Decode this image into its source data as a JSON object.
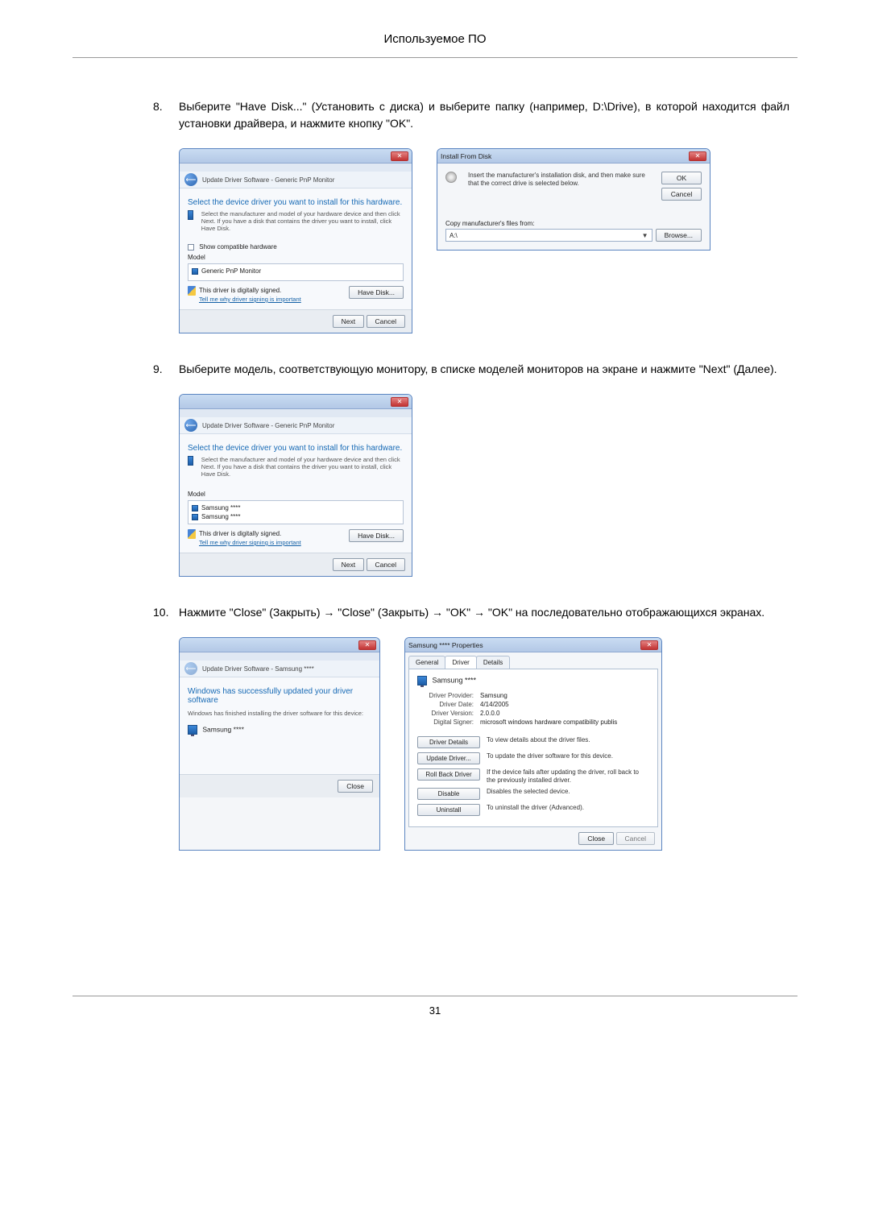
{
  "header_title": "Используемое ПО",
  "page_number": "31",
  "steps": {
    "s8": {
      "num": "8.",
      "text": "Выберите \"Have Disk...\" (Установить с диска) и выберите папку (например, D:\\Drive), в которой находится файл установки драйвера, и нажмите кнопку \"OK\"."
    },
    "s9": {
      "num": "9.",
      "text": "Выберите модель, соответствующую монитору, в списке моделей мониторов на экране и нажмите \"Next\" (Далее)."
    },
    "s10": {
      "num": "10.",
      "text": "Нажмите \"Close\" (Закрыть) → \"Close\" (Закрыть) → \"OK\" → \"OK\" на последовательно отображающихся экранах."
    }
  },
  "dlg1": {
    "crumb": "Update Driver Software - Generic PnP Monitor",
    "heading": "Select the device driver you want to install for this hardware.",
    "desc": "Select the manufacturer and model of your hardware device and then click Next. If you have a disk that contains the driver you want to install, click Have Disk.",
    "checkbox": "Show compatible hardware",
    "model_label": "Model",
    "model_item": "Generic PnP Monitor",
    "signed": "This driver is digitally signed.",
    "tell_me": "Tell me why driver signing is important",
    "have_disk": "Have Disk...",
    "next": "Next",
    "cancel": "Cancel"
  },
  "dlg2": {
    "title": "Install From Disk",
    "desc": "Insert the manufacturer's installation disk, and then make sure that the correct drive is selected below.",
    "ok": "OK",
    "cancel": "Cancel",
    "copy_label": "Copy manufacturer's files from:",
    "drive": "A:\\",
    "browse": "Browse..."
  },
  "dlg3": {
    "crumb": "Update Driver Software - Generic PnP Monitor",
    "heading": "Select the device driver you want to install for this hardware.",
    "desc": "Select the manufacturer and model of your hardware device and then click Next. If you have a disk that contains the driver you want to install, click Have Disk.",
    "model_label": "Model",
    "m1": "Samsung ****",
    "m2": "Samsung ****",
    "signed": "This driver is digitally signed.",
    "tell_me": "Tell me why driver signing is important",
    "have_disk": "Have Disk...",
    "next": "Next",
    "cancel": "Cancel"
  },
  "dlg4": {
    "crumb": "Update Driver Software - Samsung ****",
    "heading": "Windows has successfully updated your driver software",
    "sub": "Windows has finished installing the driver software for this device:",
    "device": "Samsung ****",
    "close": "Close"
  },
  "dlg5": {
    "title": "Samsung **** Properties",
    "tab_general": "General",
    "tab_driver": "Driver",
    "tab_details": "Details",
    "device": "Samsung ****",
    "provider_k": "Driver Provider:",
    "provider_v": "Samsung",
    "date_k": "Driver Date:",
    "date_v": "4/14/2005",
    "version_k": "Driver Version:",
    "version_v": "2.0.0.0",
    "signer_k": "Digital Signer:",
    "signer_v": "microsoft windows hardware compatibility publis",
    "b_details": "Driver Details",
    "d_details": "To view details about the driver files.",
    "b_update": "Update Driver...",
    "d_update": "To update the driver software for this device.",
    "b_rollback": "Roll Back Driver",
    "d_rollback": "If the device fails after updating the driver, roll back to the previously installed driver.",
    "b_disable": "Disable",
    "d_disable": "Disables the selected device.",
    "b_uninstall": "Uninstall",
    "d_uninstall": "To uninstall the driver (Advanced).",
    "close": "Close",
    "cancel": "Cancel"
  }
}
